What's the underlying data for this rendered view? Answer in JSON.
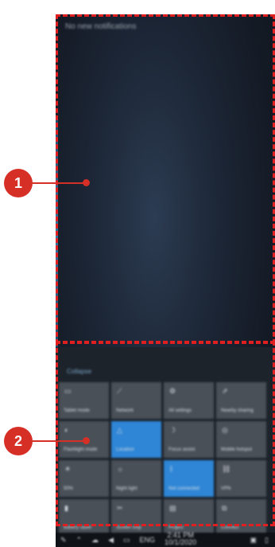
{
  "action_center": {
    "no_notifications": "No new notifications",
    "collapse_label": "Collapse"
  },
  "quick_actions": [
    {
      "label": "Tablet mode",
      "icon": "tablet-icon",
      "active": false
    },
    {
      "label": "Network",
      "icon": "network-icon",
      "active": false
    },
    {
      "label": "All settings",
      "icon": "gear-icon",
      "active": false
    },
    {
      "label": "Nearby sharing",
      "icon": "share-icon",
      "active": false
    },
    {
      "label": "Flashlight mode",
      "icon": "flashlight-icon",
      "active": false
    },
    {
      "label": "Location",
      "icon": "location-icon",
      "active": true
    },
    {
      "label": "Focus assist",
      "icon": "moon-icon",
      "active": false
    },
    {
      "label": "Mobile hotspot",
      "icon": "hotspot-icon",
      "active": false
    },
    {
      "label": "50%",
      "icon": "brightness-icon",
      "active": false
    },
    {
      "label": "Night light",
      "icon": "sun-icon",
      "active": false
    },
    {
      "label": "Not connected",
      "icon": "bluetooth-icon",
      "active": true
    },
    {
      "label": "VPN",
      "icon": "vpn-icon",
      "active": false
    },
    {
      "label": "Battery saver",
      "icon": "battery-icon",
      "active": false
    },
    {
      "label": "Screen snip",
      "icon": "scissors-icon",
      "active": false
    },
    {
      "label": "Project",
      "icon": "project-icon",
      "active": false
    },
    {
      "label": "Connect",
      "icon": "connect-icon",
      "active": false
    }
  ],
  "taskbar": {
    "language": "ENG",
    "time": "2:41 PM",
    "date": "10/1/2020"
  },
  "annotations": [
    {
      "number": "1"
    },
    {
      "number": "2"
    }
  ],
  "colors": {
    "annotation_red": "#d62f26",
    "tile_active": "#2f86d6",
    "tile_inactive": "#4a5058"
  }
}
